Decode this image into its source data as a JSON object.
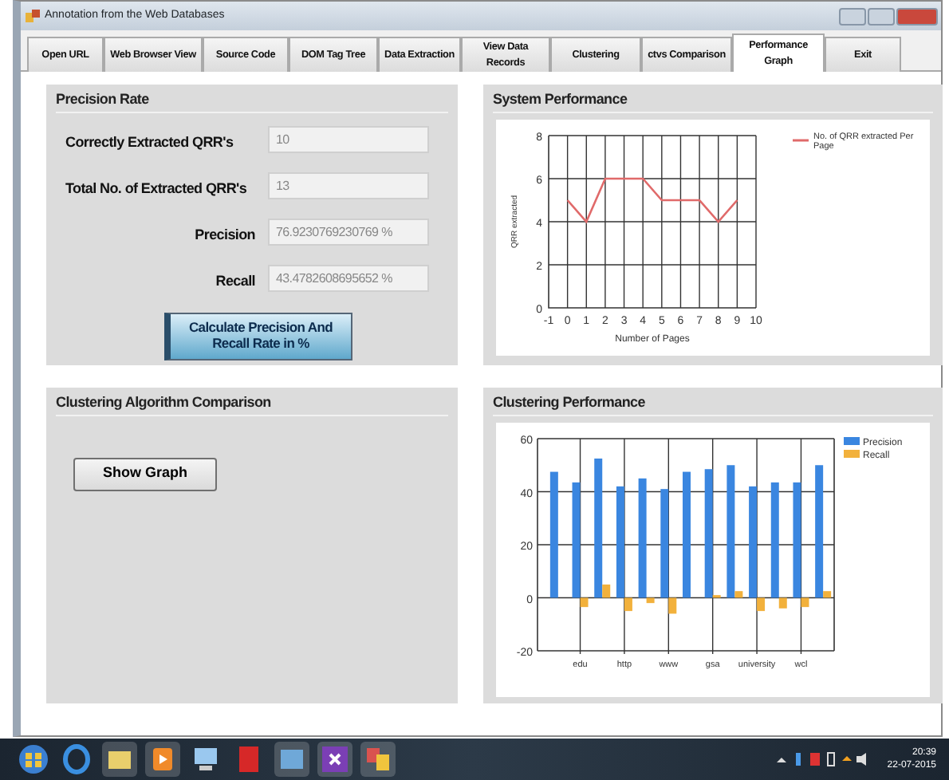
{
  "window": {
    "title": "Annotation from the Web Databases"
  },
  "tabs": [
    {
      "label": "Open URL",
      "selected": false
    },
    {
      "label": "Web Browser View",
      "selected": false
    },
    {
      "label": "Source Code",
      "selected": false
    },
    {
      "label": "DOM Tag Tree",
      "selected": false
    },
    {
      "label": "Data Extraction",
      "selected": false
    },
    {
      "label": "View Data Records",
      "selected": false
    },
    {
      "label": "Clustering",
      "selected": false
    },
    {
      "label": "ctvs Comparison",
      "selected": false
    },
    {
      "label": "Performance Graph",
      "selected": true
    },
    {
      "label": "Exit",
      "selected": false
    }
  ],
  "precision_rate": {
    "title": "Precision Rate",
    "fields": [
      {
        "label": "Correctly Extracted QRR's",
        "value": "10",
        "kind": "left"
      },
      {
        "label": "Total No. of Extracted QRR's",
        "value": "13",
        "kind": "left"
      },
      {
        "label": "Precision",
        "value": "76.9230769230769 %",
        "kind": "right"
      },
      {
        "label": "Recall",
        "value": "43.4782608695652 %",
        "kind": "right"
      }
    ],
    "button": "Calculate Precision And Recall  Rate in %"
  },
  "clustering_comparison": {
    "title": "Clustering Algorithm Comparison",
    "button": "Show Graph"
  },
  "system_performance": {
    "title": "System Performance",
    "chart_data": {
      "type": "line",
      "xlabel": "Number of Pages",
      "ylabel": "QRR extracted",
      "x": [
        0,
        1,
        2,
        3,
        4,
        5,
        6,
        7,
        8,
        9
      ],
      "series": [
        {
          "name": "No. of QRR extracted Per Page",
          "color": "#e06a6a",
          "values": [
            5,
            4,
            6,
            6,
            6,
            5,
            5,
            5,
            4,
            5
          ]
        }
      ],
      "grid": true,
      "legend": "right",
      "xlim": [
        -1,
        10
      ],
      "ylim": [
        0,
        8
      ],
      "xticks": [
        -1,
        0,
        1,
        2,
        3,
        4,
        5,
        6,
        7,
        8,
        9,
        10
      ],
      "yticks": [
        0,
        2,
        4,
        6,
        8
      ]
    }
  },
  "clustering_performance": {
    "title": "Clustering Performance",
    "chart_data": {
      "type": "bar",
      "categories": [
        null,
        "edu",
        null,
        "http",
        null,
        "www",
        null,
        "gsa",
        null,
        "university",
        null,
        "wcl",
        null
      ],
      "grid": true,
      "legend": "right",
      "series": [
        {
          "name": "Precision",
          "color": "#3a86e0",
          "values": [
            47.5,
            43.5,
            52.5,
            42,
            45,
            41,
            47.5,
            48.5,
            50,
            42,
            43.5,
            43.5,
            50
          ]
        },
        {
          "name": "Recall",
          "color": "#f2b13c",
          "values": [
            0,
            -3.5,
            5,
            -5,
            -2,
            -6,
            0,
            1,
            2.5,
            -5,
            -4,
            -3.5,
            2.5
          ]
        }
      ],
      "ylim": [
        -20,
        60
      ],
      "yticks": [
        -20,
        0,
        20,
        40,
        60
      ]
    }
  },
  "taskbar": {
    "time": "20:39",
    "date": "22-07-2015"
  }
}
